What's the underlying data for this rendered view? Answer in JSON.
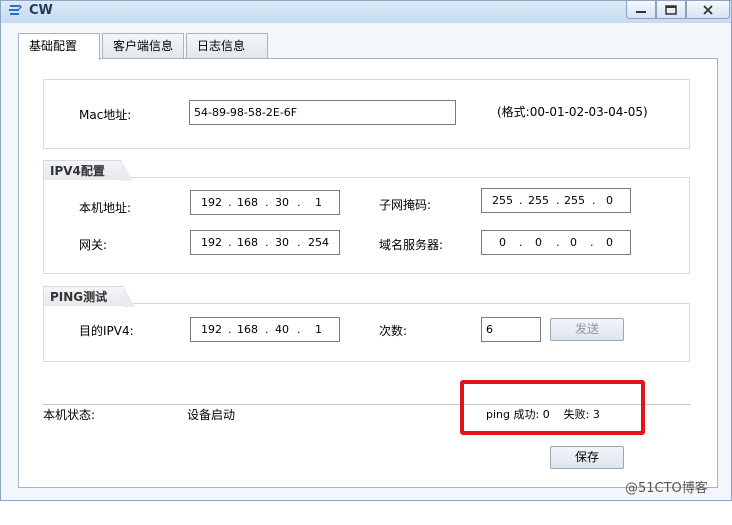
{
  "window": {
    "title": "CW"
  },
  "titlebar_buttons": {
    "minimize": "—",
    "maximize": "□",
    "close": "X"
  },
  "tabs": [
    "基础配置",
    "客户端信息",
    "日志信息"
  ],
  "mac": {
    "label": "Mac地址:",
    "value": "54-89-98-58-2E-6F",
    "format_hint": "(格式:00-01-02-03-04-05)"
  },
  "ipv4": {
    "group_title": "IPV4配置",
    "local_label": "本机地址:",
    "local": [
      "192",
      "168",
      "30",
      "1"
    ],
    "mask_label": "子网掩码:",
    "mask": [
      "255",
      "255",
      "255",
      "0"
    ],
    "gateway_label": "网关:",
    "gateway": [
      "192",
      "168",
      "30",
      "254"
    ],
    "dns_label": "域名服务器:",
    "dns": [
      "0",
      "0",
      "0",
      "0"
    ]
  },
  "ping": {
    "group_title": "PING测试",
    "target_label": "目的IPV4:",
    "target": [
      "192",
      "168",
      "40",
      "1"
    ],
    "count_label": "次数:",
    "count": "6",
    "send_label": "发送"
  },
  "status": {
    "label": "本机状态:",
    "value": "设备启动",
    "ping_result": "ping 成功: 0    失败: 3"
  },
  "save_label": "保存",
  "watermark": "@51CTO博客",
  "colors": {
    "highlight": "#e4121b",
    "titlebar": "#c7daf0"
  }
}
